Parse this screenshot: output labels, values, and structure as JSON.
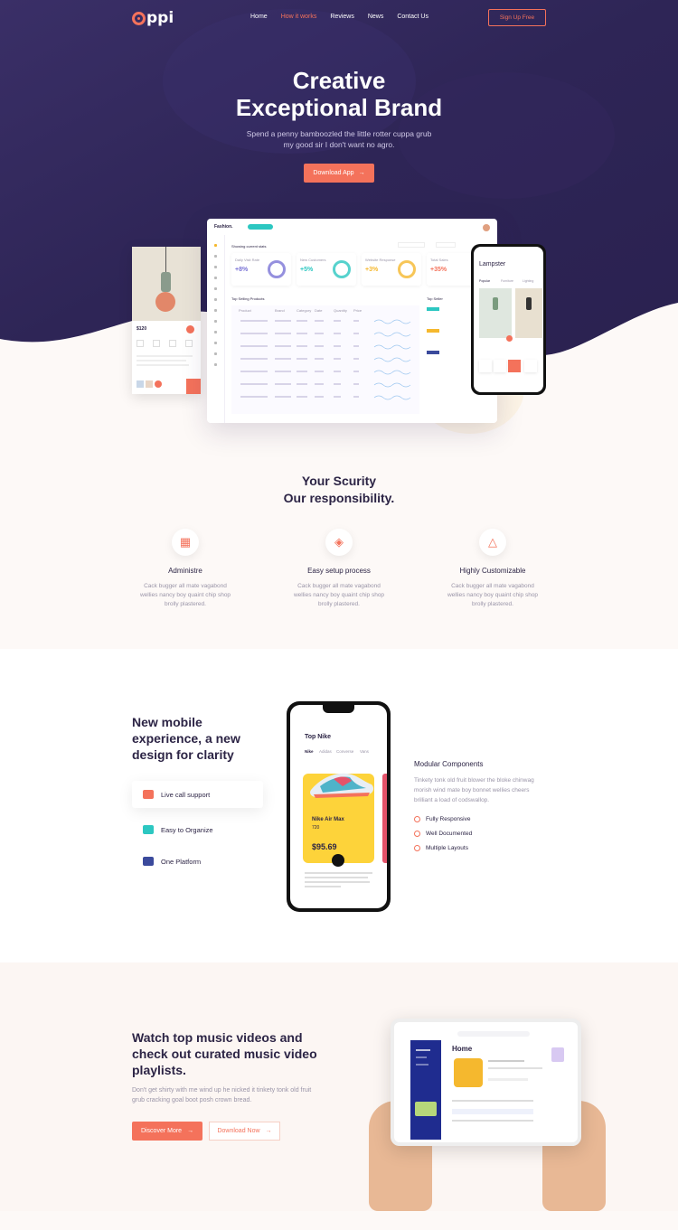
{
  "nav": {
    "logo": "ppi",
    "items": [
      {
        "label": "Home",
        "active": false
      },
      {
        "label": "How it works",
        "active": true
      },
      {
        "label": "Reviews",
        "active": false
      },
      {
        "label": "News",
        "active": false
      },
      {
        "label": "Contact Us",
        "active": false
      }
    ],
    "signup": "Sign Up Free"
  },
  "hero": {
    "title_line1": "Creative",
    "title_line2": "Exceptional Brand",
    "subtitle_line1": "Spend a penny bamboozled the little rotter cuppa grub",
    "subtitle_line2": "my good sir I don't want no agro.",
    "cta": "Download App",
    "cta_arrow": "→"
  },
  "dashboard": {
    "brand": "Fashion.",
    "section_title": "Showing current stats",
    "stats": [
      {
        "label": "Daily Visit Rate",
        "value": "+8%",
        "color": "#7b74d6"
      },
      {
        "label": "New Customers",
        "value": "+5%",
        "color": "#2cc7c1"
      },
      {
        "label": "Website Response",
        "value": "+3%",
        "color": "#f5b82e"
      },
      {
        "label": "Total Sales",
        "value": "+35%",
        "color": "#f4725b"
      }
    ],
    "table_title": "Top Selling Products",
    "side_title": "Top Seller",
    "columns": [
      "Product",
      "Brand",
      "Category",
      "Date",
      "Quantity",
      "Price"
    ]
  },
  "phone_small": {
    "title": "Lampster",
    "tabs": [
      "Popular",
      "Furniture",
      "Lighting"
    ]
  },
  "lamp_card": {
    "price": "$120"
  },
  "security": {
    "title_line1": "Your Scurity",
    "title_line2": "Our responsibility.",
    "features": [
      {
        "icon": "calendar-icon",
        "title": "Administre",
        "desc1": "Cack bugger all mate vagabond",
        "desc2": "wellies nancy boy quaint chip shop",
        "desc3": "brolly plastered."
      },
      {
        "icon": "tag-icon",
        "title": "Easy setup process",
        "desc1": "Cack bugger all mate vagabond",
        "desc2": "wellies nancy boy quaint chip shop",
        "desc3": "brolly plastered."
      },
      {
        "icon": "bell-icon",
        "title": "Highly Customizable",
        "desc1": "Cack bugger all mate vagabond",
        "desc2": "wellies nancy boy quaint chip shop",
        "desc3": "brolly plastered."
      }
    ]
  },
  "mobile": {
    "title_line1": "New mobile",
    "title_line2": "experience, a new",
    "title_line3": "design for clarity",
    "features": [
      {
        "label": "Live call support",
        "color": "#f4725b"
      },
      {
        "label": "Easy to Organize",
        "color": "#2cc7c1"
      },
      {
        "label": "One Platform",
        "color": "#3b4a9c"
      }
    ],
    "phone": {
      "title": "Top Nike",
      "tabs": [
        "Nike",
        "Adidas",
        "Converse",
        "Vans"
      ],
      "product": "Nike Air Max",
      "model": "720",
      "price": "$95.69"
    },
    "modular_title": "Modular Components",
    "modular_desc1": "Tinkety tonk old fruit blower the bloke chinwag",
    "modular_desc2": "morish wind mate boy bonnet wellies cheers",
    "modular_desc3": "brilliant a load of codswallop.",
    "checks": [
      "Fully Responsive",
      "Well Documented",
      "Multiple Layouts"
    ]
  },
  "music": {
    "title_line1": "Watch top music videos and",
    "title_line2": "check out curated music video",
    "title_line3": "playlists.",
    "desc_line1": "Don't get shirty with me wind up he nicked it tinkety tonk old fruit",
    "desc_line2": "grub cracking goal boot posh crown bread.",
    "btn_primary": "Discover More",
    "btn_secondary": "Download Now",
    "tablet_title": "Home"
  },
  "colors": {
    "accent": "#f4725b",
    "hero": "#2e2556",
    "text": "#2c2445"
  }
}
